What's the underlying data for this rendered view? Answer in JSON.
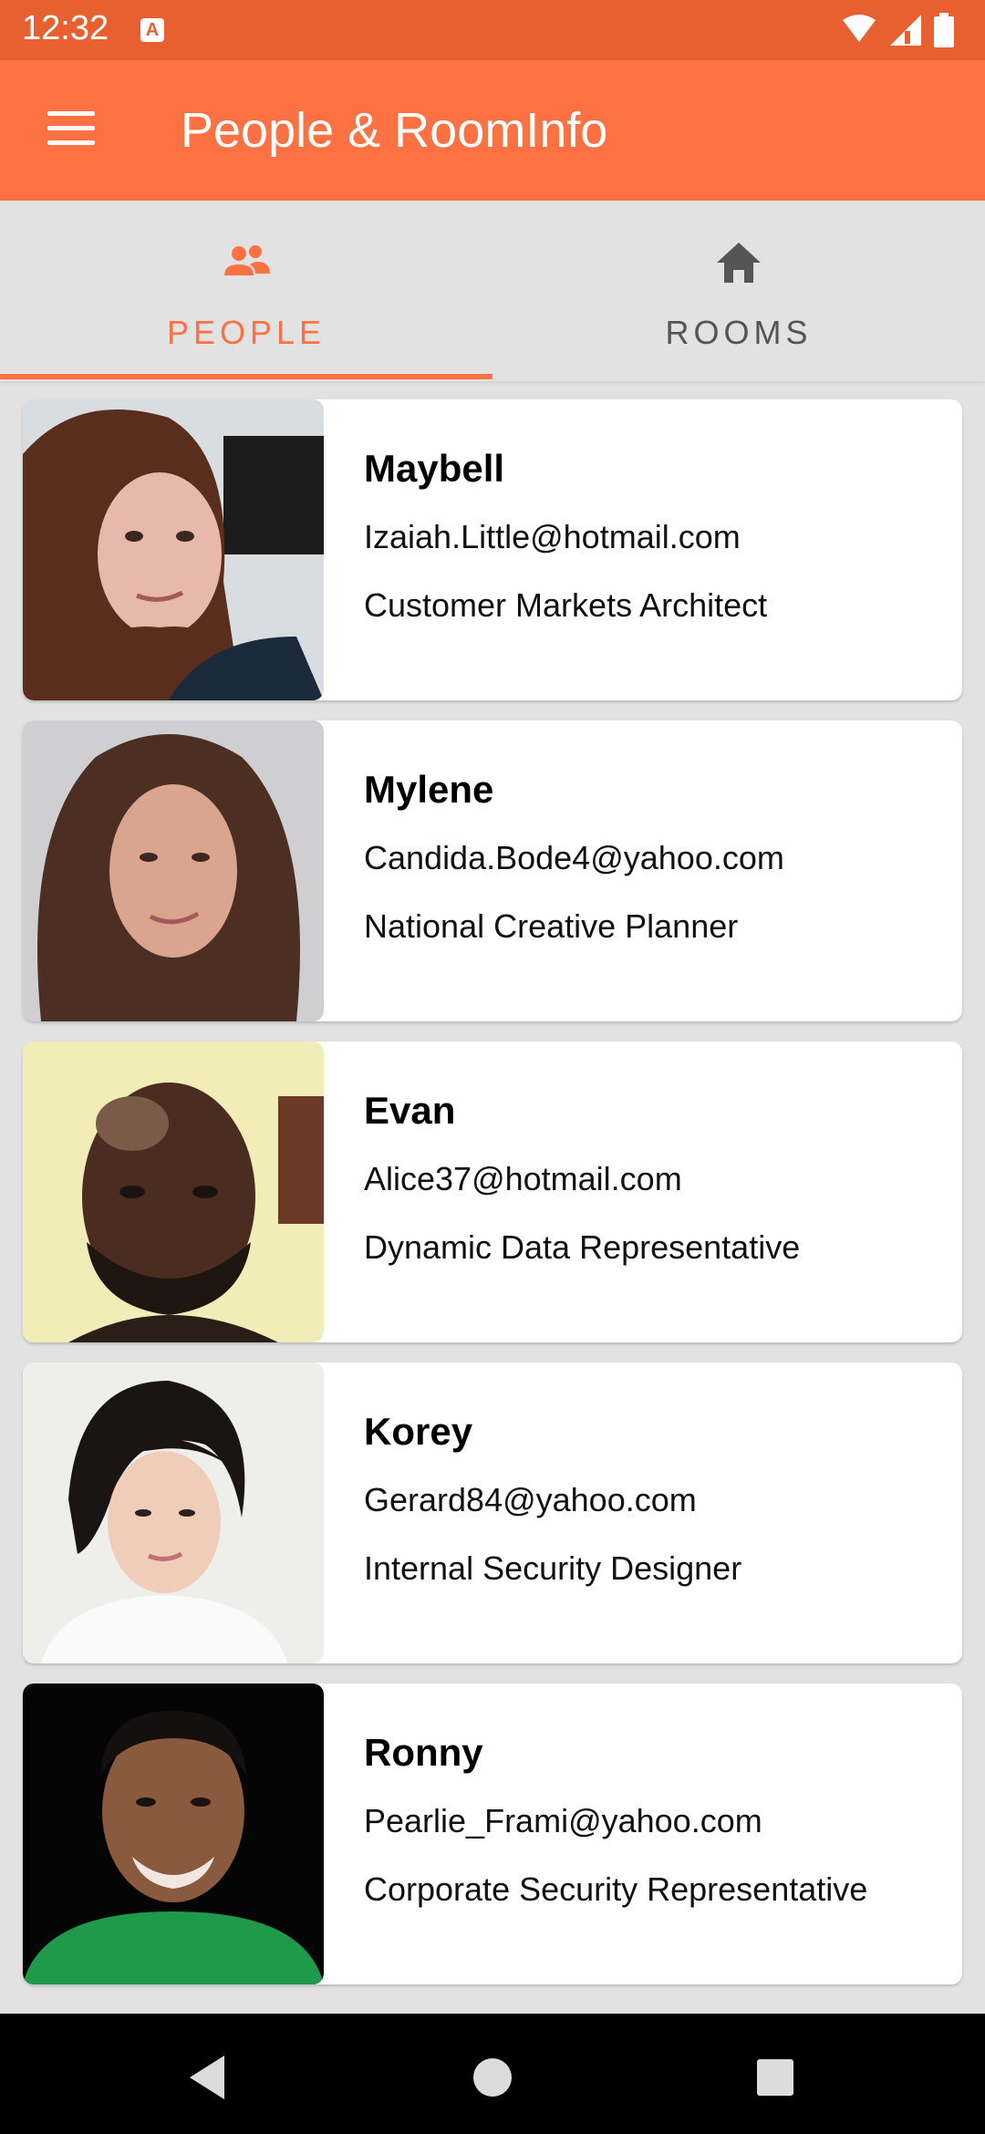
{
  "status_bar": {
    "time": "12:32",
    "notification_icon": "A",
    "icons": [
      "wifi-icon",
      "signal-icon",
      "battery-icon"
    ]
  },
  "app_bar": {
    "title": "People & RoomInfo",
    "menu_icon": "hamburger-menu-icon",
    "background_color": "#fd7143"
  },
  "tabs": [
    {
      "label": "PEOPLE",
      "icon": "people-icon",
      "selected": true
    },
    {
      "label": "ROOMS",
      "icon": "home-icon",
      "selected": false
    }
  ],
  "accent_color": "#fd7143",
  "people": [
    {
      "name": "Maybell",
      "email": "Izaiah.Little@hotmail.com",
      "role": "Customer Markets Architect"
    },
    {
      "name": "Mylene",
      "email": "Candida.Bode4@yahoo.com",
      "role": "National Creative Planner"
    },
    {
      "name": "Evan",
      "email": "Alice37@hotmail.com",
      "role": "Dynamic Data Representative"
    },
    {
      "name": "Korey",
      "email": "Gerard84@yahoo.com",
      "role": "Internal Security Designer"
    },
    {
      "name": "Ronny",
      "email": "Pearlie_Frami@yahoo.com",
      "role": "Corporate Security Representative"
    }
  ],
  "nav_bar": {
    "buttons": [
      "back-icon",
      "home-circle-icon",
      "recents-square-icon"
    ]
  }
}
